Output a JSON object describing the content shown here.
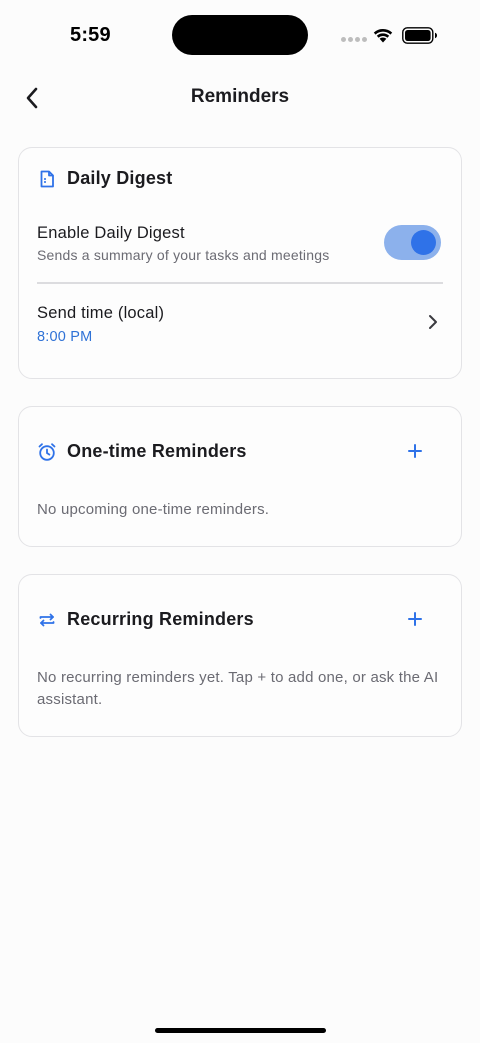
{
  "status_bar": {
    "time": "5:59"
  },
  "nav": {
    "title": "Reminders",
    "back_icon": "chevron-left-icon"
  },
  "daily_digest": {
    "title": "Daily Digest",
    "icon": "document-icon",
    "enable_label": "Enable Daily Digest",
    "enable_description": "Sends a summary of your tasks and meetings",
    "enabled": true,
    "send_time_label": "Send time (local)",
    "send_time_value": "8:00 PM"
  },
  "one_time": {
    "title": "One-time Reminders",
    "icon": "alarm-clock-icon",
    "add_label": "+",
    "empty_text": "No upcoming one-time reminders."
  },
  "recurring": {
    "title": "Recurring Reminders",
    "icon": "repeat-icon",
    "add_label": "+",
    "empty_text": "No recurring reminders yet. Tap + to add one, or ask the AI assistant."
  },
  "colors": {
    "accent": "#2f72e8",
    "toggle_track": "#8cb1ec",
    "muted_text": "#6b6b73",
    "card_border": "#e3e3e6"
  }
}
